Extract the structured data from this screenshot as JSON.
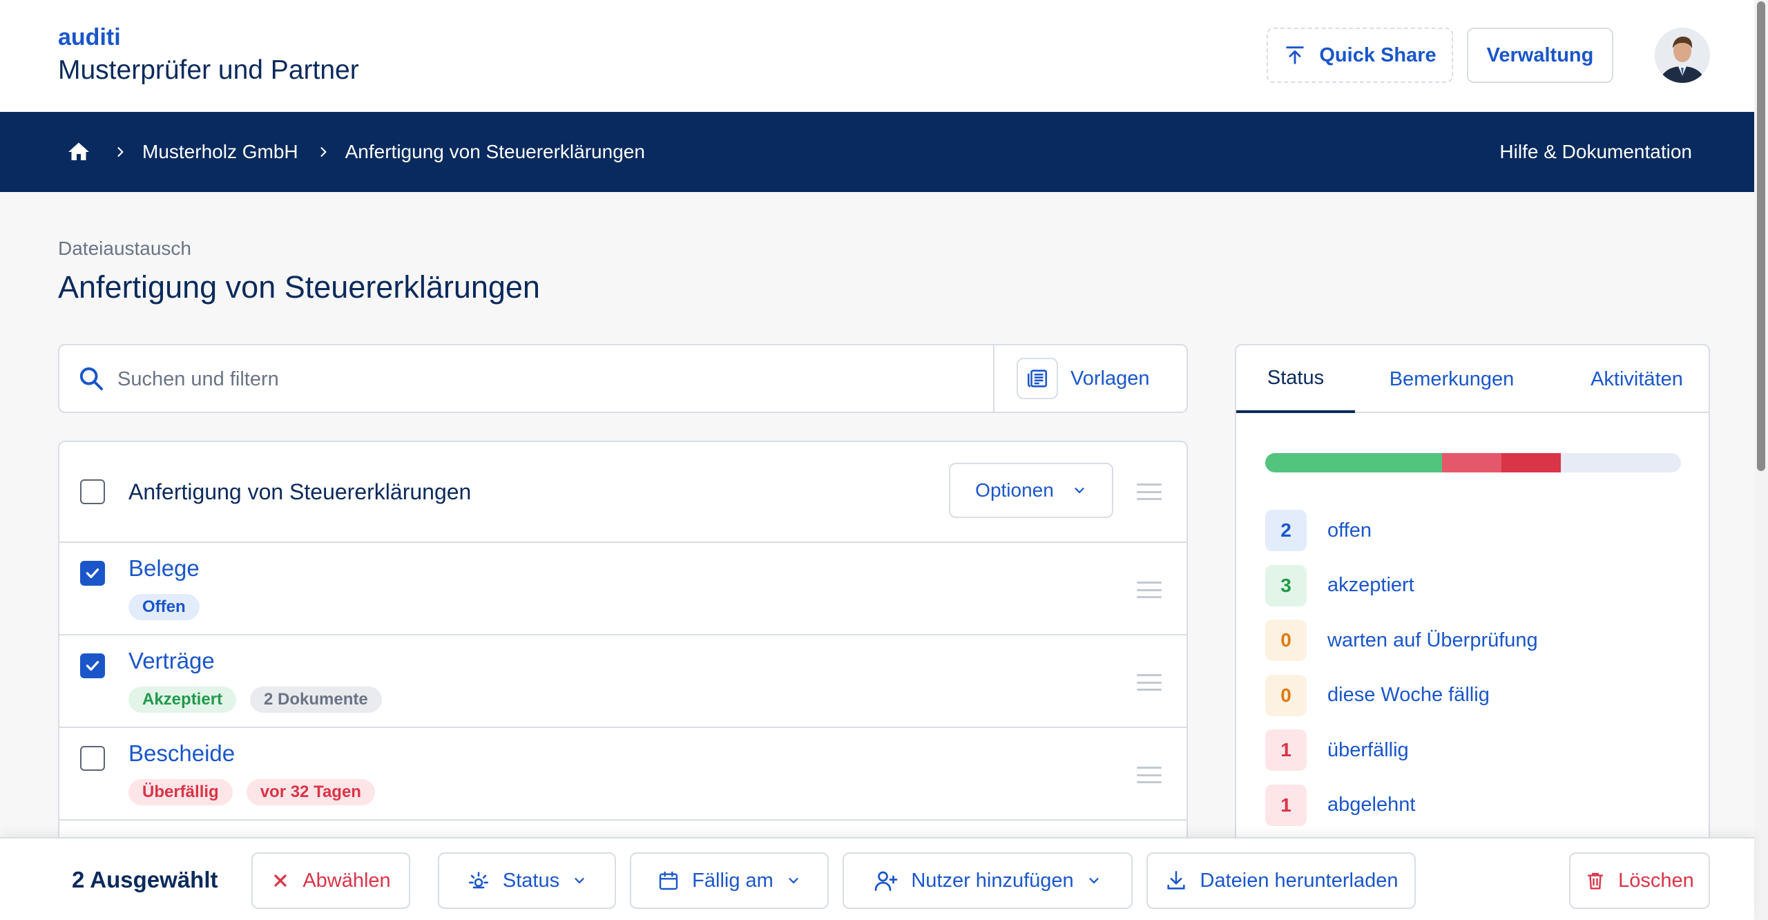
{
  "header": {
    "brand": "auditi",
    "organization": "Musterprüfer und Partner",
    "quick_share_label": "Quick Share",
    "admin_label": "Verwaltung"
  },
  "nav": {
    "breadcrumbs": [
      "Musterholz GmbH",
      "Anfertigung von Steuererklärungen"
    ],
    "help_label": "Hilfe & Dokumentation"
  },
  "page": {
    "eyebrow": "Dateiaustausch",
    "title": "Anfertigung von Steuererklärungen"
  },
  "search": {
    "placeholder": "Suchen und filtern",
    "value": "",
    "templates_label": "Vorlagen"
  },
  "list": {
    "title": "Anfertigung von Steuererklärungen",
    "options_label": "Optionen",
    "rows": [
      {
        "title": "Belege",
        "checked": true,
        "badges": [
          "Offen"
        ]
      },
      {
        "title": "Verträge",
        "checked": true,
        "badges": [
          "Akzeptiert",
          "2 Dokumente"
        ]
      },
      {
        "title": "Bescheide",
        "checked": false,
        "badges": [
          "Überfällig",
          "vor 32 Tagen"
        ]
      }
    ]
  },
  "status_panel": {
    "tabs": [
      "Status",
      "Bemerkungen",
      "Aktivitäten"
    ],
    "active_tab": "Status",
    "colors": {
      "accepted": "#52c47d",
      "overdue": "#e5576a",
      "rejected": "#d93447",
      "open": "#e6ebf6"
    },
    "items": [
      {
        "count": "2",
        "label": "offen"
      },
      {
        "count": "3",
        "label": "akzeptiert"
      },
      {
        "count": "0",
        "label": "warten auf Überprüfung"
      },
      {
        "count": "0",
        "label": "diese Woche fällig"
      },
      {
        "count": "1",
        "label": "überfällig"
      },
      {
        "count": "1",
        "label": "abgelehnt"
      }
    ]
  },
  "action_bar": {
    "selected": "2 Ausgewählt",
    "deselect_label": "Abwählen",
    "status_label": "Status",
    "due_label": "Fällig am",
    "add_user_label": "Nutzer hinzufügen",
    "download_label": "Dateien herunterladen",
    "delete_label": "Löschen"
  }
}
